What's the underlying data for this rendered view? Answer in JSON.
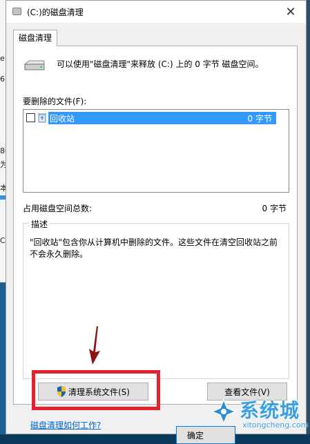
{
  "background_window": {
    "items": [
      "e",
      "6",
      "8G",
      "为",
      "本",
      "C:"
    ]
  },
  "dialog": {
    "title": "(C:)的磁盘清理",
    "close_glyph": "✕",
    "tab_label": "磁盘清理",
    "info_text": "可以使用\"磁盘清理\"来释放  (C:) 上的 0 字节 磁盘空间。",
    "files_label": "要删除的文件(F):",
    "files": [
      {
        "name": "回收站",
        "size": "0 字节",
        "checked": false,
        "selected": true
      }
    ],
    "total_label": "占用磁盘空间总数:",
    "total_value": "0 字节",
    "description_legend": "描述",
    "description_text": "\"回收站\"包含你从计算机中删除的文件。这些文件在清空回收站之前不会永久删除。",
    "clean_system_button": "清理系统文件(S)",
    "view_files_button": "查看文件(V)",
    "help_link": "磁盘清理如何工作?",
    "ok_button": "确定"
  },
  "watermark": {
    "text": "系统城",
    "url": "xitongcheng.com"
  },
  "colors": {
    "selection": "#3399ff",
    "highlight_box": "#e2222f",
    "arrow": "#8b1414",
    "link": "#0066cc"
  }
}
